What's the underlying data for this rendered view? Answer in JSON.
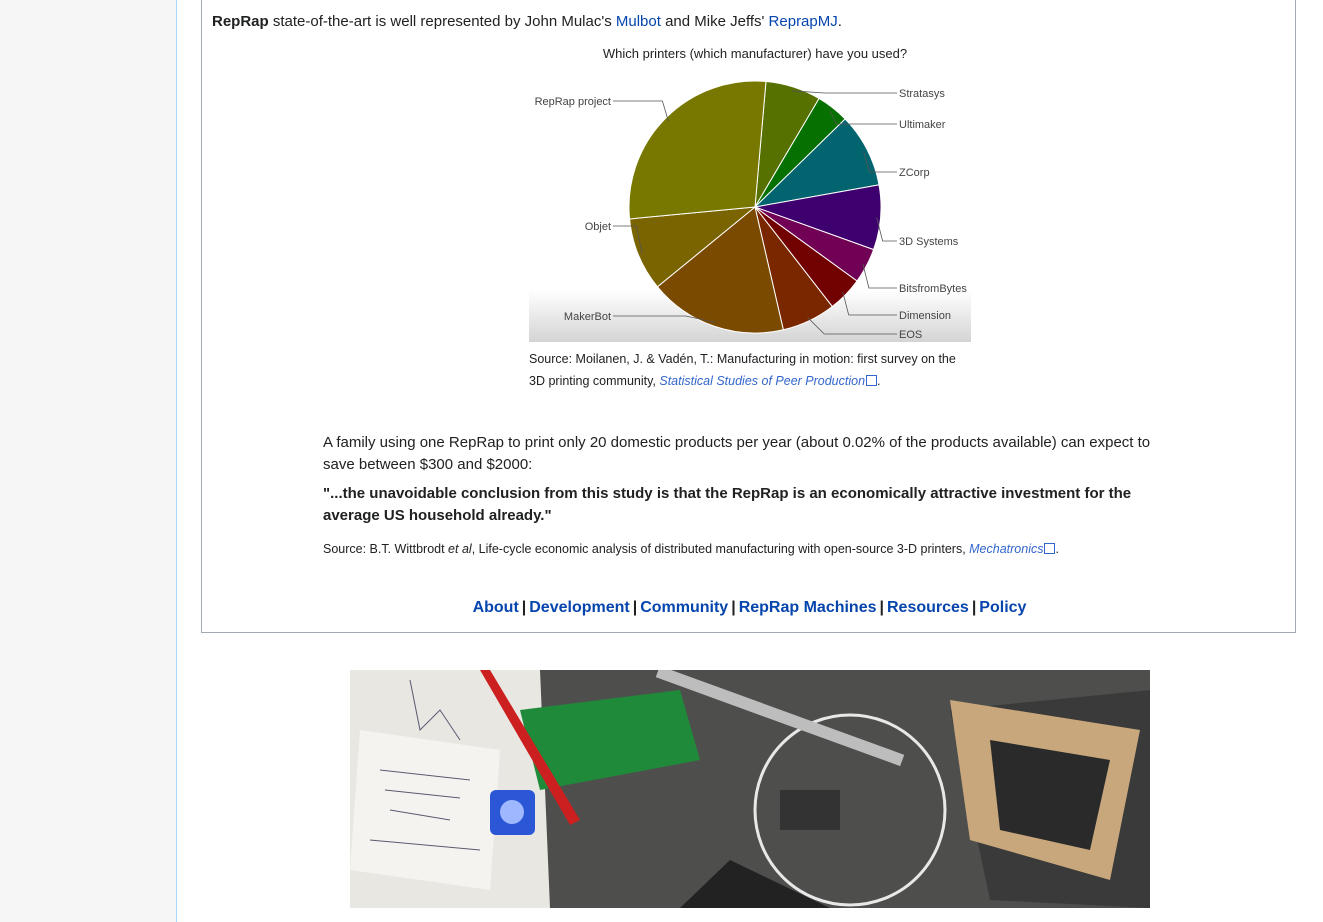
{
  "intro": {
    "bold": "RepRap",
    "text1": " state-of-the-art is well represented by John Mulac's ",
    "link1": "Mulbot",
    "text2": " and Mike Jeffs' ",
    "link2": "ReprapMJ",
    "text3": "."
  },
  "chart_data": {
    "type": "pie",
    "title": "Which printers (which manufacturer) have you used?",
    "labels": [
      "Stratasys",
      "Ultimaker",
      "ZCorp",
      "3D Systems",
      "BitsfromBytes",
      "Dimension",
      "EOS",
      "MakerBot",
      "Objet",
      "RepRap project"
    ],
    "values": [
      7.1,
      4.2,
      9.5,
      8.3,
      4.5,
      4.5,
      6.9,
      17.7,
      9.4,
      27.9
    ],
    "colors": [
      "#567100",
      "#067000",
      "#02646f",
      "#3e006f",
      "#700154",
      "#720201",
      "#7a2700",
      "#7a4a00",
      "#7a6400",
      "#787800"
    ]
  },
  "caption": {
    "text": "Source: Moilanen, J. & Vadén, T.: Manufacturing in motion: first survey on the 3D printing community, ",
    "link": "Statistical Studies of Peer Production",
    "end": "."
  },
  "para": "A family using one RepRap to print only 20 domestic products per year (about 0.02% of the products available) can expect to save between $300 and $2000:",
  "quote": "\"...the unavoidable conclusion from this study is that the RepRap is an economically attractive investment for the average US household already.\"",
  "source2": {
    "pre": "Source: B.T. Wittbrodt ",
    "etal": "et al",
    "mid": ", Life-cycle economic analysis of distributed manufacturing with open-source 3-D printers, ",
    "link": "Mechatronics",
    "end": "."
  },
  "nav": [
    "About",
    "Development",
    "Community",
    "RepRap Machines",
    "Resources",
    "Policy"
  ],
  "colors": {
    "link": "#0645ad",
    "ext_link": "#3366cc",
    "border": "#a2a9b1",
    "sidebar_bg": "#f6f6f6"
  }
}
